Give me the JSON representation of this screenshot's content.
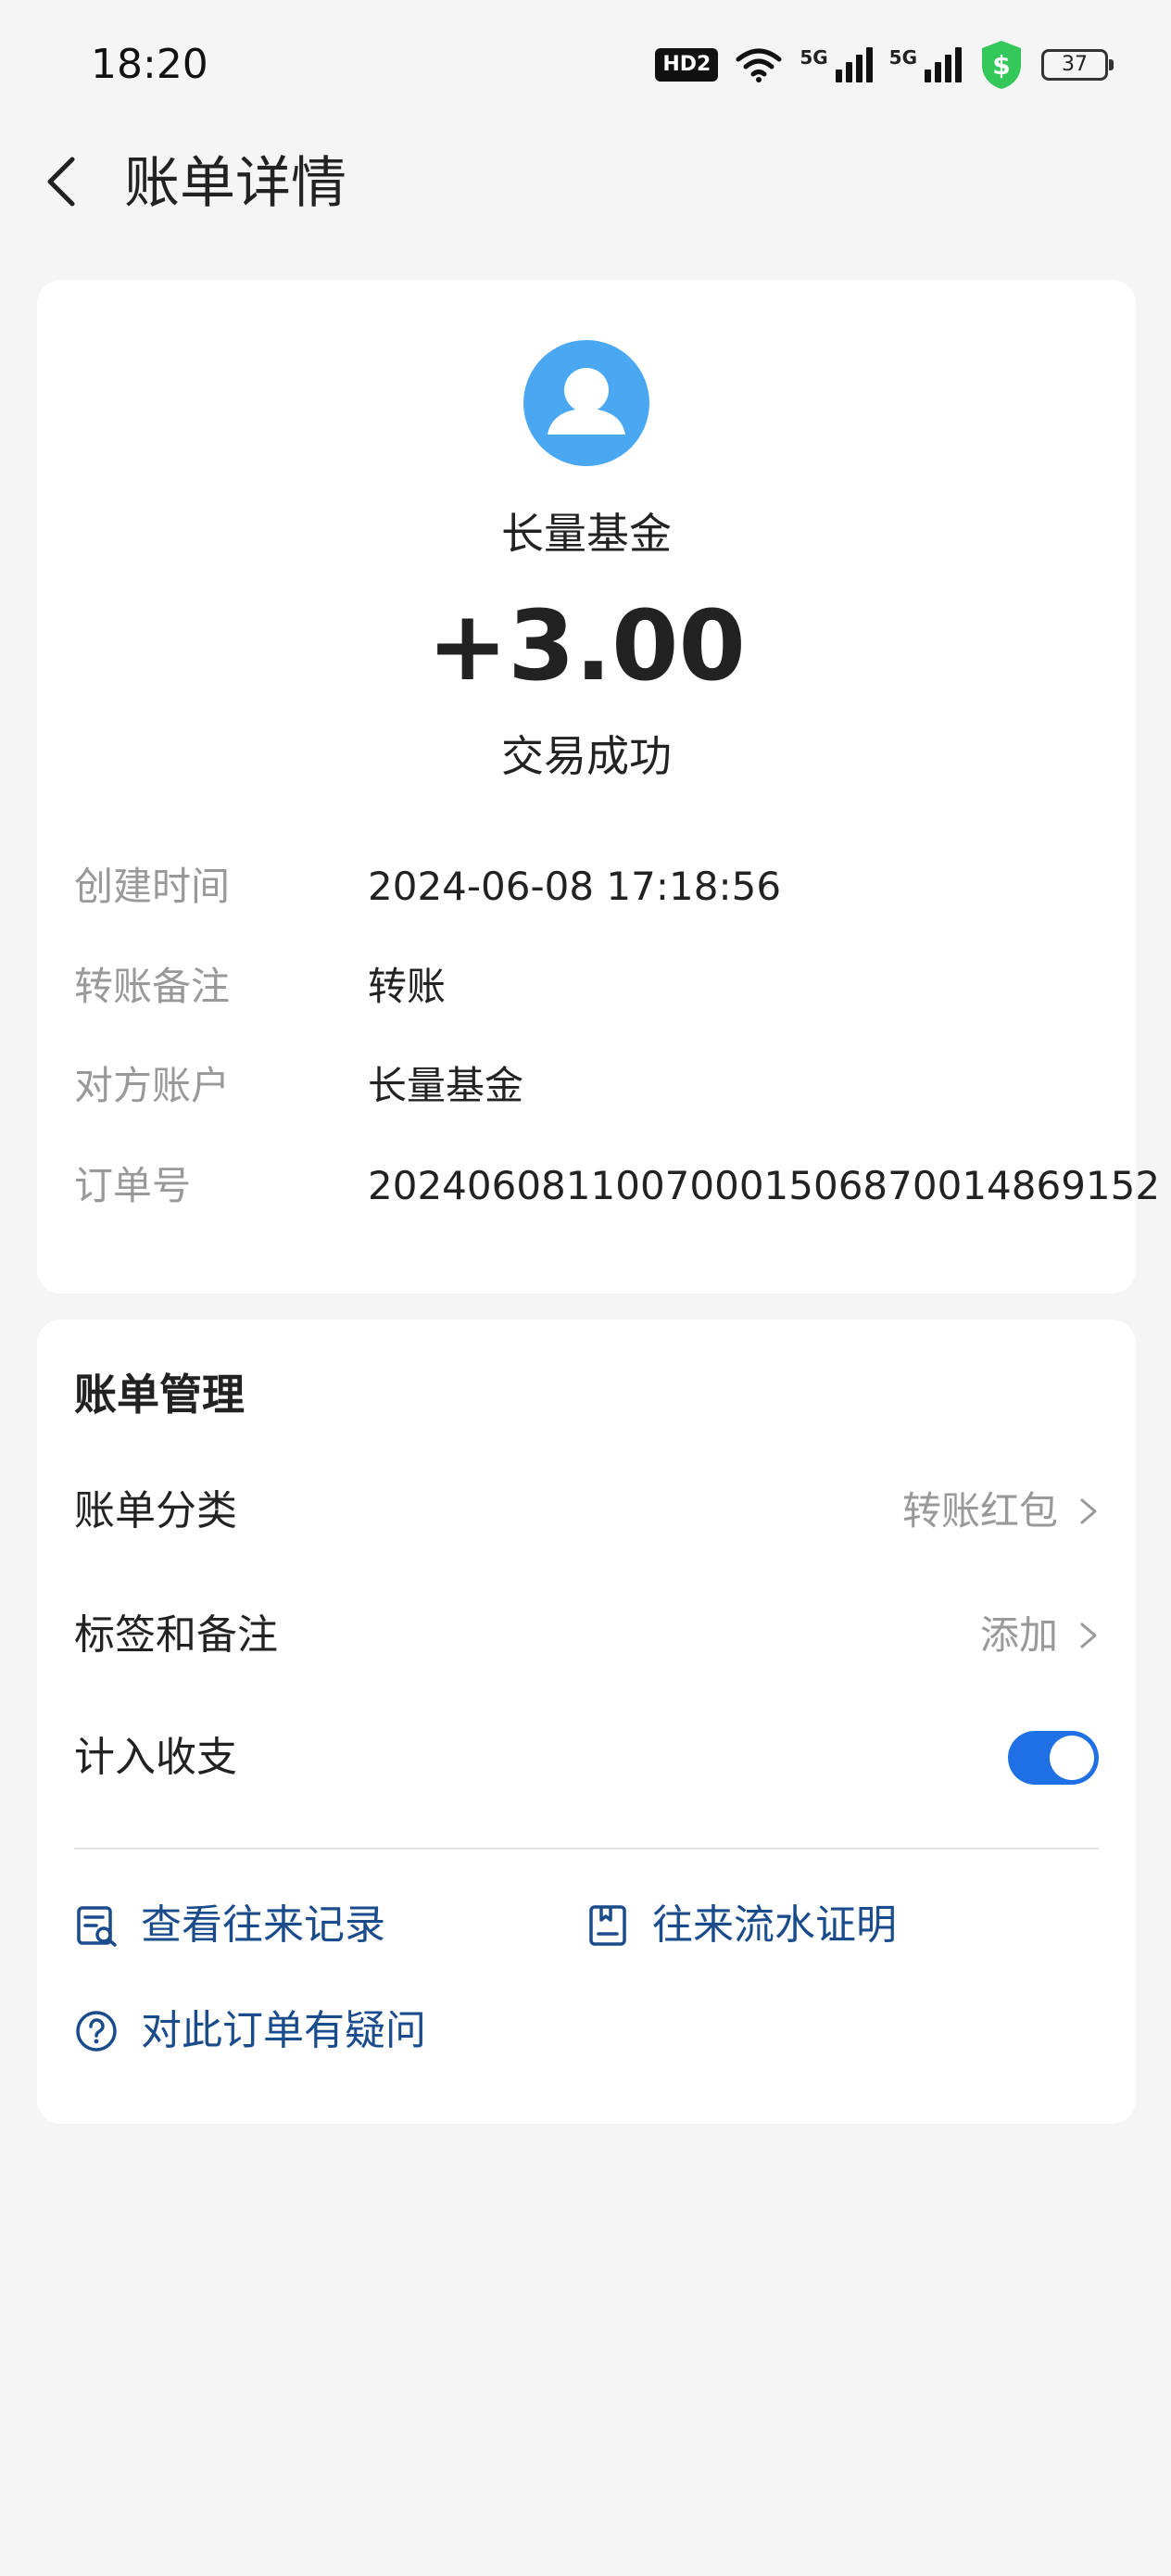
{
  "status_bar": {
    "time": "18:20",
    "hd_badge": "HD2",
    "signal1_label": "5G",
    "signal2_label": "5G",
    "battery": "37",
    "security_color": "#34c759"
  },
  "header": {
    "back_icon": "chevron-left-icon",
    "title": "账单详情"
  },
  "summary": {
    "avatar_icon": "user-avatar-icon",
    "avatar_color": "#4aa8f2",
    "payee": "长量基金",
    "amount": "+3.00",
    "status": "交易成功"
  },
  "details": [
    {
      "label": "创建时间",
      "value": "2024-06-08 17:18:56"
    },
    {
      "label": "转账备注",
      "value": "转账"
    },
    {
      "label": "对方账户",
      "value": "长量基金"
    },
    {
      "label": "订单号",
      "value": "2024060811007000150687001486915 2"
    }
  ],
  "management": {
    "title": "账单管理",
    "category_label": "账单分类",
    "category_value": "转账红包",
    "tags_label": "标签和备注",
    "tags_value": "添加",
    "include_label": "计入收支",
    "include_on": true,
    "accent": "#1f6fe5",
    "links": {
      "history": "查看往来记录",
      "statement": "往来流水证明",
      "question": "对此订单有疑问"
    }
  }
}
